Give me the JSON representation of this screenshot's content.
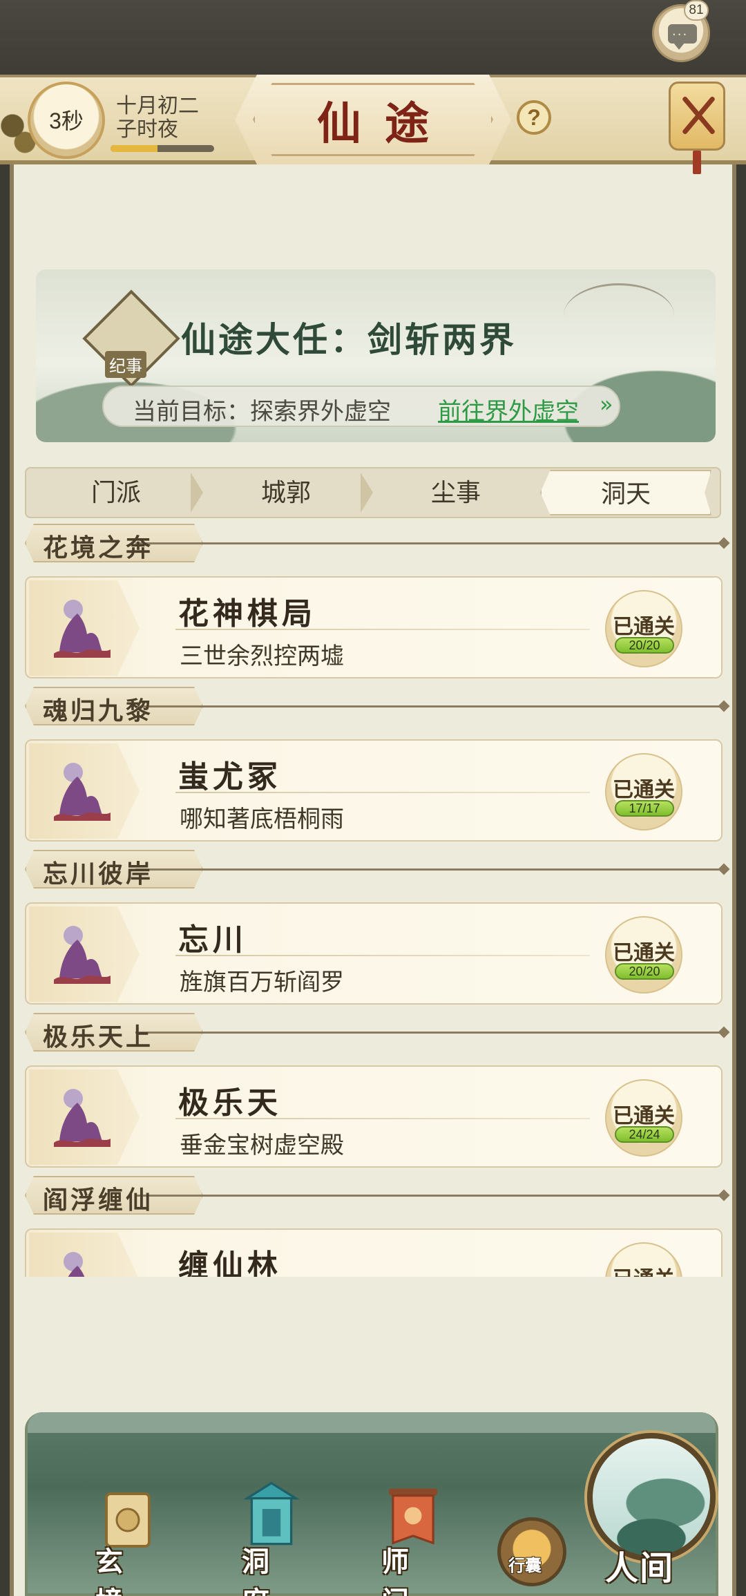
{
  "chat": {
    "badge_count": "81",
    "icon": "chat-bubble-icon"
  },
  "header": {
    "title": "仙途",
    "timer": "3秒",
    "date_line1": "十月初二",
    "date_line2": "子时夜",
    "time_progress": 0.45,
    "help_symbol": "?",
    "close_icon": "close-icon"
  },
  "quest": {
    "scroll_label": "纪事",
    "title": "仙途大任：剑斩两界",
    "goal_label": "当前目标：探索界外虚空",
    "goal_link": "前往界外虚空",
    "goal_arrow": "»"
  },
  "tabs": [
    {
      "label": "门派",
      "active": false
    },
    {
      "label": "城郭",
      "active": false
    },
    {
      "label": "尘事",
      "active": false
    },
    {
      "label": "洞天",
      "active": true
    }
  ],
  "sections": [
    {
      "header": "花境之奔",
      "name": "花神棋局",
      "subtitle": "三世余烈控两墟",
      "status": "已通关",
      "progress": "20/20"
    },
    {
      "header": "魂归九黎",
      "name": "蚩尤冢",
      "subtitle": "哪知著底梧桐雨",
      "status": "已通关",
      "progress": "17/17"
    },
    {
      "header": "忘川彼岸",
      "name": "忘川",
      "subtitle": "旌旗百万斩阎罗",
      "status": "已通关",
      "progress": "20/20"
    },
    {
      "header": "极乐天上",
      "name": "极乐天",
      "subtitle": "垂金宝树虚空殿",
      "status": "已通关",
      "progress": "24/24"
    },
    {
      "header": "阎浮缠仙",
      "name": "缠仙林",
      "subtitle": "",
      "status": "已通关",
      "progress": ""
    }
  ],
  "bottom_nav": {
    "items": [
      {
        "label": "玄境",
        "icon": "scroll-icon"
      },
      {
        "label": "洞府",
        "icon": "pavilion-icon"
      },
      {
        "label": "师门",
        "icon": "banner-icon"
      }
    ],
    "bag_label": "行囊",
    "main_label": "人间"
  },
  "colors": {
    "title_red": "#7d2416",
    "link_green": "#2f9a45",
    "progress_green": "#8cc63f",
    "panel_bg": "#ecebdc"
  }
}
